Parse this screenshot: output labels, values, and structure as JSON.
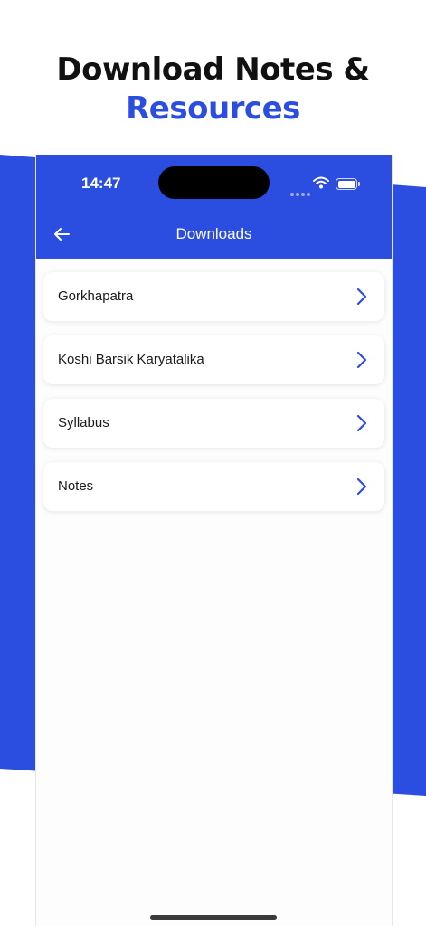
{
  "promo": {
    "headline_line1": "Download Notes &",
    "headline_line2": "Resources"
  },
  "status_bar": {
    "time": "14:47"
  },
  "app_bar": {
    "title": "Downloads"
  },
  "downloads": [
    {
      "label": "Gorkhapatra"
    },
    {
      "label": "Koshi Barsik Karyatalika"
    },
    {
      "label": "Syllabus"
    },
    {
      "label": "Notes"
    }
  ],
  "colors": {
    "brand_blue": "#2b4de0",
    "text_dark": "#111111",
    "chevron": "#2b4de0"
  }
}
